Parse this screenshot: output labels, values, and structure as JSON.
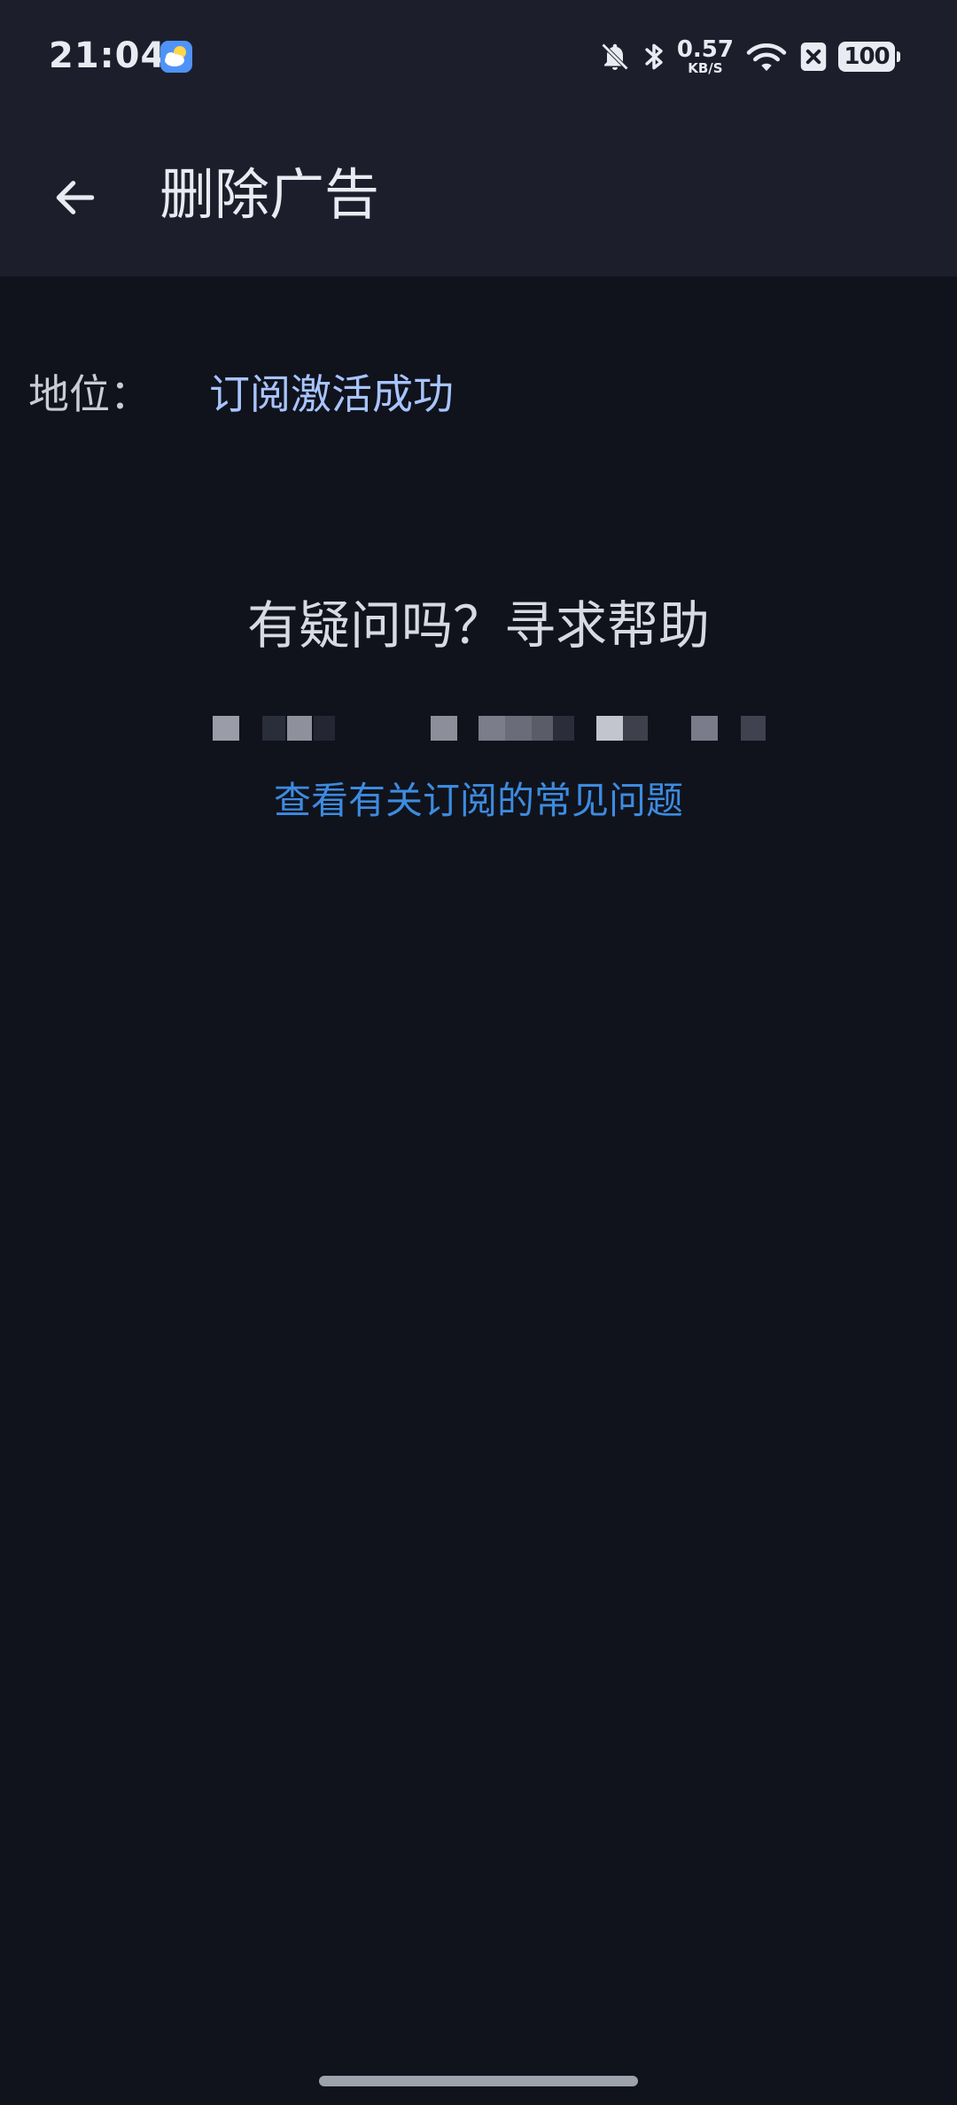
{
  "status_bar": {
    "time": "21:04",
    "app_icon": "weather-icon",
    "net_speed_value": "0.57",
    "net_speed_unit": "KB/S",
    "battery_level": "100",
    "icons": [
      "bell-off-icon",
      "bluetooth-icon",
      "wifi-icon",
      "close-box-icon",
      "battery-icon"
    ]
  },
  "app_bar": {
    "back_icon": "arrow-left-icon",
    "title": "删除广告"
  },
  "subscription": {
    "label": "地位：",
    "value": "订阅激活成功"
  },
  "help": {
    "title": "有疑问吗？寻求帮助",
    "faq_link": "查看有关订阅的常见问题"
  },
  "colors": {
    "background": "#10131c",
    "top_bar": "#1c1f2b",
    "status_value": "#a8c4ff",
    "link": "#3d8be0"
  }
}
